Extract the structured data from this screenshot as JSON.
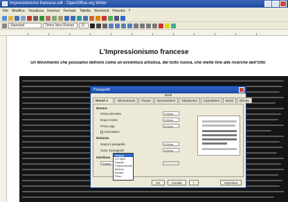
{
  "window": {
    "title": "Impressionismo francese.odt - OpenOffice.org Writer"
  },
  "menubar": {
    "items": [
      "File",
      "Modifica",
      "Visualizza",
      "Inserisci",
      "Formato",
      "Tabella",
      "Strumenti",
      "Finestra",
      "?"
    ]
  },
  "toolbar": {
    "style_value": "Standard",
    "font_value": "Times New Roman",
    "size_value": "12"
  },
  "document": {
    "title": "L'Impressionismo francese",
    "subtitle": "Un Movimento che possiamo definire come un'avventura artistica, del tutto nuova, che mette fine alle ricerche dell'Otto"
  },
  "dialog": {
    "title": "Paragrafo",
    "section_label": "Bordi",
    "tabs": [
      "Rientri e spaziature",
      "Allineamento",
      "Flusso di testo",
      "Numerazione",
      "Tabulazioni",
      "Capolettera",
      "Bordi",
      "Sfondo"
    ],
    "group_indent": "Rientro",
    "before_label": "Prima del testo",
    "before_value": "0,00cm",
    "after_label": "Dopo il testo",
    "after_value": "0,00cm",
    "first_label": "Prima riga",
    "first_value": "0,00cm",
    "auto_label": "Automatico",
    "group_spacing": "Distanza",
    "above_label": "Sopra il paragrafo",
    "above_value": "0,00cm",
    "below_label": "Sotto il paragrafo",
    "below_value": "0,00cm",
    "group_interline": "Interlinea",
    "interline_value": "Singola",
    "interline_options": [
      "Singola",
      "1,5 righe",
      "Doppia",
      "Proporzionale",
      "Minimo",
      "Iniziale",
      "Fisso"
    ],
    "buttons": {
      "ok": "OK",
      "cancel": "Annulla",
      "help": "?",
      "reset": "Ripristina"
    }
  }
}
